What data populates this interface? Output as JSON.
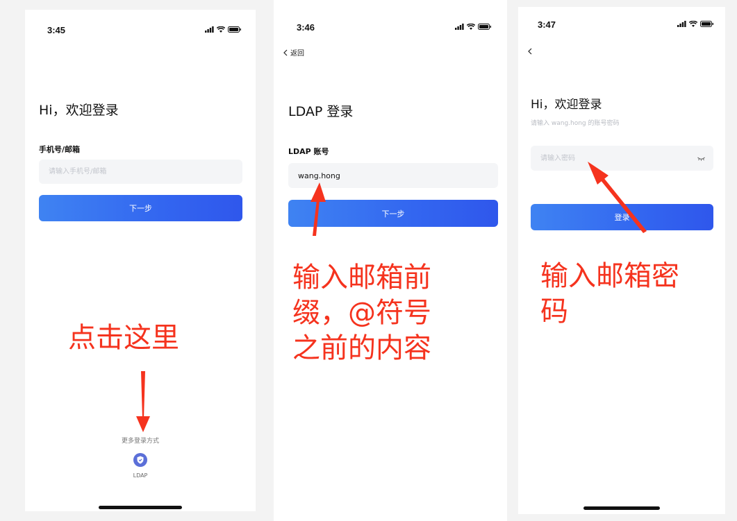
{
  "screen1": {
    "time": "3:45",
    "heading": "Hi，欢迎登录",
    "field_label": "手机号/邮箱",
    "input_placeholder": "请输入手机号/邮箱",
    "next_button": "下一步",
    "annotation": "点击这里",
    "more_login": "更多登录方式",
    "ldap_option": "LDAP"
  },
  "screen2": {
    "time": "3:46",
    "back_label": "返回",
    "heading": "LDAP 登录",
    "field_label": "LDAP 账号",
    "input_value": "wang.hong",
    "next_button": "下一步",
    "annotation": "输入邮箱前\n缀，@符号\n之前的内容"
  },
  "screen3": {
    "time": "3:47",
    "heading": "Hi，欢迎登录",
    "subtitle": "请输入 wang.hong 的账号密码",
    "password_placeholder": "请输入密码",
    "login_button": "登录",
    "annotation": "输入邮箱密\n码"
  },
  "icons": {
    "signal": "signal-icon",
    "wifi": "wifi-icon",
    "battery": "battery-icon",
    "back": "chevron-left-icon",
    "eye": "eye-closed-icon",
    "ldap": "shield-icon"
  },
  "colors": {
    "primary": "#3366f0",
    "annotation": "#f5331e",
    "ldap_icon": "#5b6fd8"
  }
}
